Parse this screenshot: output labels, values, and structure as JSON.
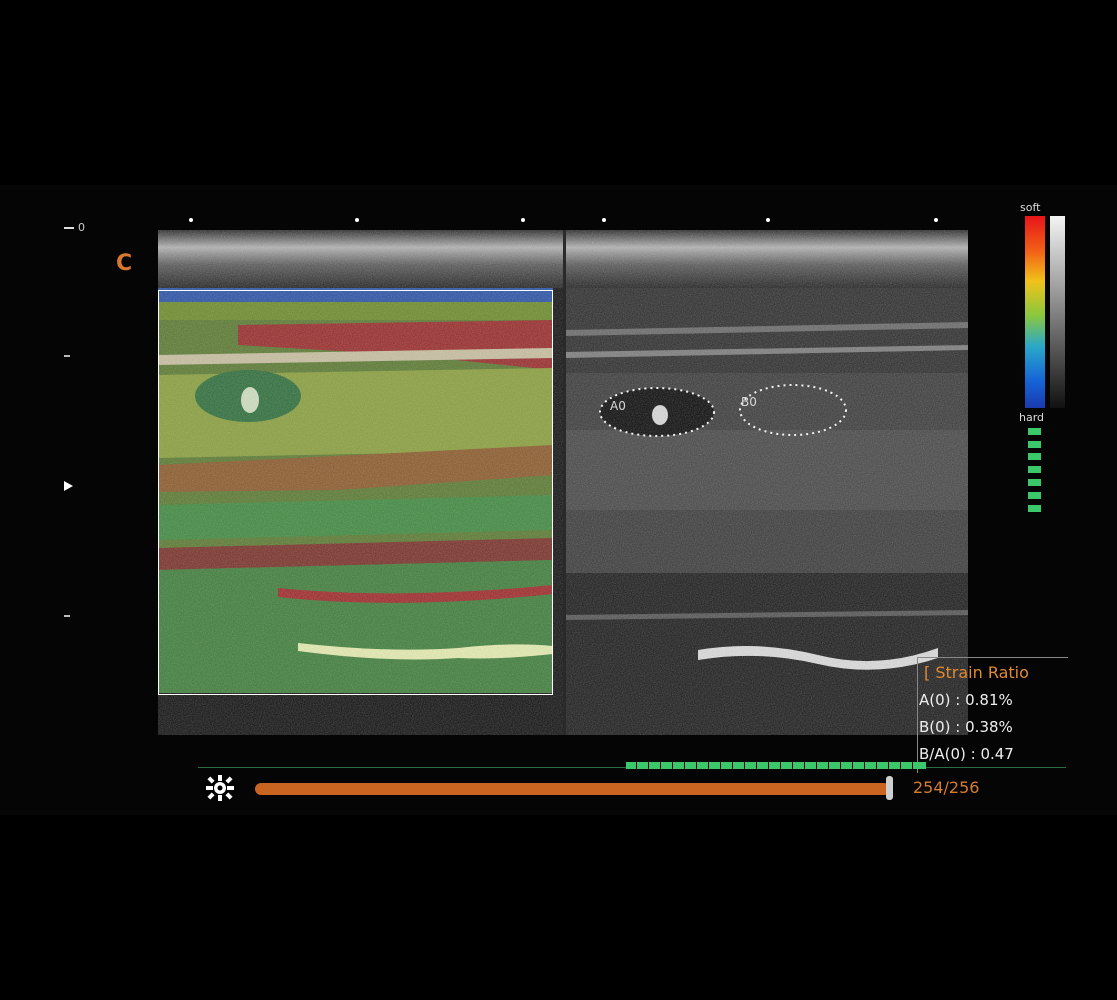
{
  "screen": {
    "probe_mark": "C",
    "depth_zero_label": "0"
  },
  "legend": {
    "soft_label": "soft",
    "hard_label": "hard",
    "color_top": "#e8141a",
    "color_bottom": "#1a3ab0",
    "quality_indicator_segments": 7
  },
  "rois": {
    "a_label": "A0",
    "b_label": "B0"
  },
  "strain_ratio": {
    "title": "[ Strain Ratio",
    "lines": [
      "A(0) : 0.81%",
      "B(0) : 0.38%",
      "B/A(0) : 0.47"
    ]
  },
  "cine": {
    "settings_icon": "gear-icon",
    "frame_counter": "254/256",
    "progress": 0.992
  },
  "colors": {
    "accent": "#d9772e",
    "quality_green": "#3cc76b"
  }
}
